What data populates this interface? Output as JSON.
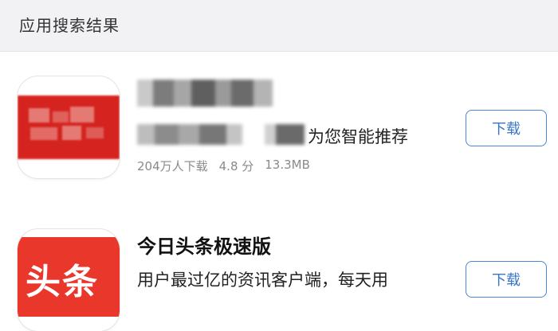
{
  "section_title": "应用搜索结果",
  "apps": [
    {
      "title": "",
      "description_suffix": "为您智能推荐",
      "downloads": "204万人下载",
      "rating": "4.8 分",
      "size": "13.3MB",
      "button_label": "下载"
    },
    {
      "title": "今日头条极速版",
      "icon_text": "头条",
      "description": "用户最过亿的资讯客户端，每天用",
      "button_label": "下载"
    }
  ],
  "colors": {
    "header_bg": "#f2f2f4",
    "accent_blue": "#4a86d8",
    "brand_red": "#d5241f"
  }
}
